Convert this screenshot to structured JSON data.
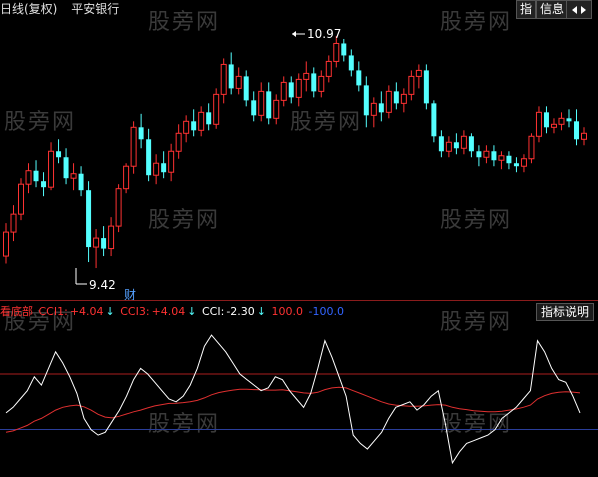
{
  "header": {
    "chart_mode": "日线(复权)",
    "stock_name": "平安银行",
    "btn_index": "指",
    "btn_info": "信息"
  },
  "watermark": "股旁网",
  "price_chart": {
    "high_label": "10.97",
    "low_label": "9.42",
    "event_marker": "财",
    "up_color": "#ff3232",
    "down_color": "#54ffff",
    "ohlc": [
      [
        9.5,
        9.72,
        9.45,
        9.66
      ],
      [
        9.66,
        9.84,
        9.6,
        9.78
      ],
      [
        9.78,
        10.02,
        9.74,
        9.98
      ],
      [
        9.98,
        10.12,
        9.92,
        10.07
      ],
      [
        10.07,
        10.14,
        9.96,
        10.0
      ],
      [
        10.0,
        10.06,
        9.9,
        9.96
      ],
      [
        9.96,
        10.26,
        9.94,
        10.2
      ],
      [
        10.2,
        10.28,
        10.12,
        10.16
      ],
      [
        10.16,
        10.22,
        9.98,
        10.02
      ],
      [
        10.02,
        10.12,
        9.94,
        10.05
      ],
      [
        10.05,
        10.1,
        9.9,
        9.94
      ],
      [
        9.94,
        10.0,
        9.46,
        9.56
      ],
      [
        9.56,
        9.68,
        9.42,
        9.62
      ],
      [
        9.62,
        9.7,
        9.5,
        9.55
      ],
      [
        9.55,
        9.76,
        9.5,
        9.7
      ],
      [
        9.7,
        9.98,
        9.66,
        9.95
      ],
      [
        9.95,
        10.12,
        9.92,
        10.1
      ],
      [
        10.1,
        10.4,
        10.05,
        10.36
      ],
      [
        10.36,
        10.45,
        10.22,
        10.28
      ],
      [
        10.28,
        10.35,
        10.0,
        10.04
      ],
      [
        10.04,
        10.18,
        9.98,
        10.12
      ],
      [
        10.12,
        10.2,
        10.02,
        10.06
      ],
      [
        10.06,
        10.25,
        10.0,
        10.2
      ],
      [
        10.2,
        10.38,
        10.15,
        10.32
      ],
      [
        10.32,
        10.44,
        10.26,
        10.4
      ],
      [
        10.4,
        10.48,
        10.3,
        10.34
      ],
      [
        10.34,
        10.5,
        10.3,
        10.46
      ],
      [
        10.46,
        10.52,
        10.34,
        10.38
      ],
      [
        10.38,
        10.62,
        10.35,
        10.58
      ],
      [
        10.58,
        10.82,
        10.52,
        10.78
      ],
      [
        10.78,
        10.86,
        10.58,
        10.62
      ],
      [
        10.62,
        10.76,
        10.58,
        10.7
      ],
      [
        10.7,
        10.74,
        10.5,
        10.54
      ],
      [
        10.54,
        10.6,
        10.4,
        10.44
      ],
      [
        10.44,
        10.66,
        10.4,
        10.6
      ],
      [
        10.6,
        10.66,
        10.38,
        10.42
      ],
      [
        10.42,
        10.58,
        10.38,
        10.54
      ],
      [
        10.54,
        10.7,
        10.5,
        10.66
      ],
      [
        10.66,
        10.7,
        10.52,
        10.56
      ],
      [
        10.56,
        10.72,
        10.5,
        10.68
      ],
      [
        10.68,
        10.8,
        10.6,
        10.72
      ],
      [
        10.72,
        10.76,
        10.56,
        10.6
      ],
      [
        10.6,
        10.74,
        10.56,
        10.7
      ],
      [
        10.7,
        10.84,
        10.66,
        10.8
      ],
      [
        10.8,
        10.97,
        10.76,
        10.92
      ],
      [
        10.92,
        10.95,
        10.8,
        10.84
      ],
      [
        10.84,
        10.88,
        10.7,
        10.74
      ],
      [
        10.74,
        10.8,
        10.6,
        10.64
      ],
      [
        10.64,
        10.7,
        10.36,
        10.44
      ],
      [
        10.44,
        10.56,
        10.36,
        10.52
      ],
      [
        10.52,
        10.6,
        10.4,
        10.46
      ],
      [
        10.46,
        10.64,
        10.42,
        10.6
      ],
      [
        10.6,
        10.66,
        10.48,
        10.52
      ],
      [
        10.52,
        10.62,
        10.46,
        10.58
      ],
      [
        10.58,
        10.74,
        10.54,
        10.7
      ],
      [
        10.7,
        10.78,
        10.62,
        10.74
      ],
      [
        10.74,
        10.78,
        10.48,
        10.52
      ],
      [
        10.52,
        10.54,
        10.26,
        10.3
      ],
      [
        10.3,
        10.34,
        10.16,
        10.2
      ],
      [
        10.2,
        10.3,
        10.16,
        10.26
      ],
      [
        10.26,
        10.32,
        10.18,
        10.22
      ],
      [
        10.22,
        10.34,
        10.18,
        10.3
      ],
      [
        10.3,
        10.32,
        10.16,
        10.2
      ],
      [
        10.2,
        10.24,
        10.1,
        10.16
      ],
      [
        10.16,
        10.24,
        10.12,
        10.2
      ],
      [
        10.2,
        10.24,
        10.1,
        10.14
      ],
      [
        10.14,
        10.2,
        10.08,
        10.17
      ],
      [
        10.17,
        10.2,
        10.08,
        10.12
      ],
      [
        10.12,
        10.16,
        10.06,
        10.1
      ],
      [
        10.1,
        10.18,
        10.06,
        10.15
      ],
      [
        10.15,
        10.32,
        10.12,
        10.3
      ],
      [
        10.3,
        10.5,
        10.26,
        10.46
      ],
      [
        10.46,
        10.5,
        10.32,
        10.36
      ],
      [
        10.36,
        10.42,
        10.32,
        10.38
      ],
      [
        10.38,
        10.46,
        10.34,
        10.42
      ],
      [
        10.42,
        10.48,
        10.36,
        10.4
      ],
      [
        10.4,
        10.48,
        10.24,
        10.28
      ],
      [
        10.28,
        10.36,
        10.24,
        10.32
      ]
    ]
  },
  "indicator": {
    "name": "看底部",
    "cci1_label": "CCI1:",
    "cci1_value": "+4.04",
    "cci1_color": "#ff3232",
    "cci3_label": "CCI3:",
    "cci3_value": "+4.04",
    "cci3_color": "#ff3232",
    "cci_label": "CCI:",
    "cci_value": "-2.30",
    "cci_color": "#ffffff",
    "ref1_label": "100.0",
    "ref1_color": "#ff3232",
    "ref2_label": "-100.0",
    "ref2_color": "#3264ff",
    "help_button": "指标说明",
    "cci_series": [
      -40,
      -20,
      10,
      40,
      90,
      60,
      120,
      180,
      140,
      90,
      30,
      -60,
      -100,
      -120,
      -110,
      -70,
      -30,
      20,
      80,
      120,
      100,
      70,
      40,
      10,
      0,
      20,
      60,
      120,
      200,
      240,
      210,
      180,
      140,
      100,
      80,
      60,
      40,
      50,
      90,
      80,
      40,
      10,
      -20,
      30,
      120,
      220,
      160,
      90,
      20,
      -120,
      -150,
      -170,
      -140,
      -110,
      -60,
      -20,
      -10,
      0,
      -30,
      -10,
      20,
      40,
      -80,
      -220,
      -180,
      -150,
      -140,
      -130,
      -120,
      -100,
      -60,
      -40,
      -20,
      10,
      40,
      220,
      180,
      120,
      80,
      70,
      20,
      -40
    ],
    "ma_series": [
      -110,
      -105,
      -95,
      -85,
      -70,
      -60,
      -45,
      -30,
      -20,
      -15,
      -12,
      -18,
      -30,
      -45,
      -55,
      -58,
      -52,
      -44,
      -36,
      -30,
      -22,
      -15,
      -10,
      -6,
      -5,
      -3,
      0,
      5,
      14,
      25,
      33,
      38,
      42,
      45,
      45,
      44,
      43,
      42,
      42,
      43,
      40,
      36,
      32,
      30,
      34,
      44,
      50,
      52,
      50,
      40,
      30,
      20,
      10,
      0,
      -8,
      -12,
      -14,
      -16,
      -16,
      -15,
      -12,
      -10,
      -12,
      -20,
      -25,
      -28,
      -32,
      -34,
      -36,
      -36,
      -34,
      -30,
      -26,
      -20,
      -12,
      10,
      22,
      30,
      34,
      36,
      35,
      32
    ]
  }
}
